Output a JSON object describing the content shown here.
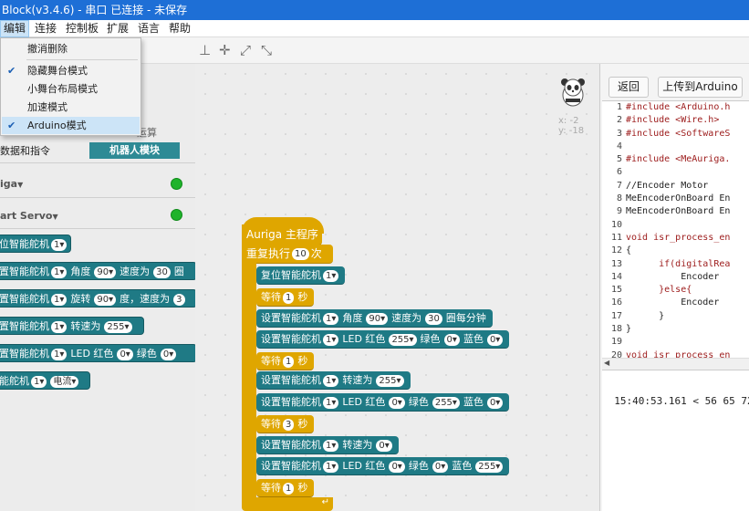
{
  "window": {
    "title": "Block(v3.4.6) - 串口 已连接 - 未保存"
  },
  "menubar": [
    "编辑",
    "连接",
    "控制板",
    "扩展",
    "语言",
    "帮助"
  ],
  "toolbar": {
    "icons": [
      "stage-icon",
      "fit-icon",
      "expand-icon",
      "shrink-icon"
    ],
    "glyphs": [
      "⊥",
      "✛",
      "⤢",
      "⤡"
    ]
  },
  "edit_menu": {
    "items": [
      {
        "label": "撤消删除",
        "checked": false,
        "highlighted": false
      },
      {
        "label": "隐藏舞台模式",
        "checked": true,
        "highlighted": false
      },
      {
        "label": "小舞台布局模式",
        "checked": false,
        "highlighted": false
      },
      {
        "label": "加速模式",
        "checked": false,
        "highlighted": false
      },
      {
        "label": "Arduino模式",
        "checked": true,
        "highlighted": true
      }
    ]
  },
  "palette": {
    "categories": {
      "operators_partial": "运算",
      "data_partial": "数据和指令",
      "robots": "机器人模块"
    },
    "devices": [
      {
        "name": "iga",
        "arrow": "▼",
        "status_color": "#1fb32b"
      },
      {
        "name": "art Servo",
        "arrow": "▼",
        "status_color": "#1fb32b"
      }
    ],
    "blocks": [
      {
        "text": "位智能舵机",
        "fields": [
          "1▾"
        ]
      },
      {
        "text": "置智能舵机",
        "fields": [
          "1▾",
          "角度",
          "90▾",
          "速度为",
          "30",
          "圈"
        ]
      },
      {
        "text": "置智能舵机",
        "fields": [
          "1▾",
          "旋转",
          "90▾",
          "度，速度为",
          "3"
        ]
      },
      {
        "text": "置智能舵机",
        "fields": [
          "1▾",
          "转速为",
          "255▾"
        ]
      },
      {
        "text": "置智能舵机",
        "fields": [
          "1▾",
          "LED 红色",
          "0▾",
          "绿色",
          "0▾"
        ]
      },
      {
        "text": "能舵机",
        "fields": [
          "1▾",
          "电流▾"
        ]
      }
    ]
  },
  "workspace": {
    "coords": {
      "x": "x: -2",
      "y": "y: -18"
    },
    "hat_label": "Auriga 主程序",
    "loop": {
      "prefix": "重复执行",
      "count": "10",
      "suffix": "次"
    },
    "script": [
      {
        "type": "teal",
        "text": "复位智能舵机",
        "fields": [
          "1▾"
        ]
      },
      {
        "type": "gold",
        "text": "等待",
        "fields": [
          "1",
          "秒"
        ]
      },
      {
        "type": "teal",
        "text": "设置智能舵机",
        "fields": [
          "1▾",
          "角度",
          "90▾",
          "速度为",
          "30",
          "圈每分钟"
        ]
      },
      {
        "type": "teal",
        "text": "设置智能舵机",
        "fields": [
          "1▾",
          "LED 红色",
          "255▾",
          "绿色",
          "0▾",
          "蓝色",
          "0▾"
        ]
      },
      {
        "type": "gold",
        "text": "等待",
        "fields": [
          "1",
          "秒"
        ]
      },
      {
        "type": "teal",
        "text": "设置智能舵机",
        "fields": [
          "1▾",
          "转速为",
          "255▾"
        ]
      },
      {
        "type": "teal",
        "text": "设置智能舵机",
        "fields": [
          "1▾",
          "LED 红色",
          "0▾",
          "绿色",
          "255▾",
          "蓝色",
          "0▾"
        ]
      },
      {
        "type": "gold",
        "text": "等待",
        "fields": [
          "3",
          "秒"
        ]
      },
      {
        "type": "teal",
        "text": "设置智能舵机",
        "fields": [
          "1▾",
          "转速为",
          "0▾"
        ]
      },
      {
        "type": "teal",
        "text": "设置智能舵机",
        "fields": [
          "1▾",
          "LED 红色",
          "0▾",
          "绿色",
          "0▾",
          "蓝色",
          "255▾"
        ]
      },
      {
        "type": "gold",
        "text": "等待",
        "fields": [
          "1",
          "秒"
        ]
      }
    ]
  },
  "right_panel": {
    "back_label": "返回",
    "upload_label": "上传到Arduino",
    "code_lines": [
      {
        "n": "1",
        "t": "#include <Arduino.h"
      },
      {
        "n": "2",
        "t": "#include <Wire.h>"
      },
      {
        "n": "3",
        "t": "#include <SoftwareS"
      },
      {
        "n": "4",
        "t": ""
      },
      {
        "n": "5",
        "t": "#include <MeAuriga."
      },
      {
        "n": "6",
        "t": ""
      },
      {
        "n": "7",
        "t": "//Encoder Motor"
      },
      {
        "n": "8",
        "t": "MeEncoderOnBoard En"
      },
      {
        "n": "9",
        "t": "MeEncoderOnBoard En"
      },
      {
        "n": "10",
        "t": ""
      },
      {
        "n": "11",
        "t": "void isr_process_en"
      },
      {
        "n": "12",
        "t": "{"
      },
      {
        "n": "13",
        "t": "      if(digitalRea"
      },
      {
        "n": "14",
        "t": "          Encoder"
      },
      {
        "n": "15",
        "t": "      }else{"
      },
      {
        "n": "16",
        "t": "          Encoder"
      },
      {
        "n": "17",
        "t": "      }"
      },
      {
        "n": "18",
        "t": "}"
      },
      {
        "n": "19",
        "t": ""
      },
      {
        "n": "20",
        "t": "void isr_process_en"
      }
    ],
    "serial_text": "15:40:53.161 < 56 65 72"
  },
  "colors": {
    "accent": "#1e6fd6",
    "robot_block": "#1f7a85",
    "control_block": "#dfa600",
    "status": "#1fb32b"
  }
}
